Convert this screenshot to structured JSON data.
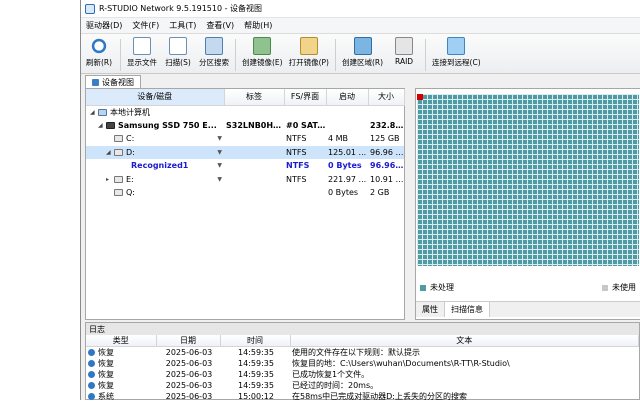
{
  "window": {
    "title": "R-STUDIO Network 9.5.191510 - 设备视图"
  },
  "menu": [
    "驱动器(D)",
    "文件(F)",
    "工具(T)",
    "查看(V)",
    "帮助(H)"
  ],
  "toolbar": [
    {
      "label": "刷新(R)",
      "icon": "refresh-icon"
    },
    {
      "label": "显示文件",
      "icon": "show-files-icon"
    },
    {
      "label": "扫描(S)",
      "icon": "scan-icon"
    },
    {
      "label": "分区搜索",
      "icon": "partition-search-icon"
    },
    {
      "label": "创建镜像(E)",
      "icon": "create-image-icon"
    },
    {
      "label": "打开镜像(P)",
      "icon": "open-image-icon"
    },
    {
      "label": "创建区域(R)",
      "icon": "create-region-icon"
    },
    {
      "label": "RAID",
      "icon": "raid-icon"
    },
    {
      "label": "连接到远程(C)",
      "icon": "remote-connect-icon"
    }
  ],
  "tab": {
    "label": "设备视图"
  },
  "devices": {
    "columns": [
      "设备/磁盘",
      "标签",
      "FS/界面",
      "启动",
      "大小"
    ],
    "rows": [
      {
        "name": "本地计算机",
        "label": "",
        "fs": "",
        "start": "",
        "size": "",
        "indent": 0,
        "expander": "◢",
        "icon": "computer-icon",
        "style": ""
      },
      {
        "name": "Samsung SSD 750 E...",
        "label": "S32LNB0H9...",
        "fs": "#0 SATA2, SSD",
        "start": "",
        "size": "232.89 ...",
        "indent": 1,
        "expander": "◢",
        "icon": "ssd-icon",
        "style": "bold"
      },
      {
        "name": "C:",
        "label": "",
        "fs": "NTFS",
        "start": "4 MB",
        "size": "125 GB",
        "indent": 2,
        "expander": "",
        "icon": "partition-icon",
        "style": "",
        "dropdown": true
      },
      {
        "name": "D:",
        "label": "",
        "fs": "NTFS",
        "start": "125.01 ...",
        "size": "96.96 GB",
        "indent": 2,
        "expander": "◢",
        "icon": "partition-icon",
        "style": "selected",
        "dropdown": true
      },
      {
        "name": "Recognized1",
        "label": "",
        "fs": "NTFS",
        "start": "0 Bytes",
        "size": "96.96 GB",
        "indent": 3,
        "expander": "",
        "icon": "recognized-icon",
        "style": "blue bold",
        "dropdown": true
      },
      {
        "name": "E:",
        "label": "",
        "fs": "NTFS",
        "start": "221.97 ...",
        "size": "10.91 GB",
        "indent": 2,
        "expander": "▸",
        "icon": "partition-icon",
        "style": "",
        "dropdown": true
      },
      {
        "name": "Q:",
        "label": "",
        "fs": "",
        "start": "0 Bytes",
        "size": "2 GB",
        "indent": 2,
        "expander": "",
        "icon": "partition-icon",
        "style": ""
      }
    ]
  },
  "legend": {
    "unprocessed": "未处理",
    "unused": "未使用"
  },
  "map_tabs": [
    "属性",
    "扫描信息"
  ],
  "colors": {
    "map": "#4f9aa4",
    "unused": "#c8c8c8",
    "selection": "#cde4fb",
    "marker": "#d40000"
  },
  "log": {
    "title": "日志",
    "columns": [
      "类型",
      "日期",
      "时间",
      "文本"
    ],
    "rows": [
      {
        "type": "恢复",
        "date": "2025-06-03",
        "time": "14:59:35",
        "text": "使用的文件存在以下规则：默认提示"
      },
      {
        "type": "恢复",
        "date": "2025-06-03",
        "time": "14:59:35",
        "text": "恢复目的地：C:\\Users\\wuhan\\Documents\\R-TT\\R-Studio\\"
      },
      {
        "type": "恢复",
        "date": "2025-06-03",
        "time": "14:59:35",
        "text": "已成功恢复1个文件。"
      },
      {
        "type": "恢复",
        "date": "2025-06-03",
        "time": "14:59:35",
        "text": "已经过的时间：20ms。"
      },
      {
        "type": "系统",
        "date": "2025-06-03",
        "time": "15:00:12",
        "text": "在58ms中已完成对驱动器D:上丢失的分区的搜索"
      }
    ]
  }
}
